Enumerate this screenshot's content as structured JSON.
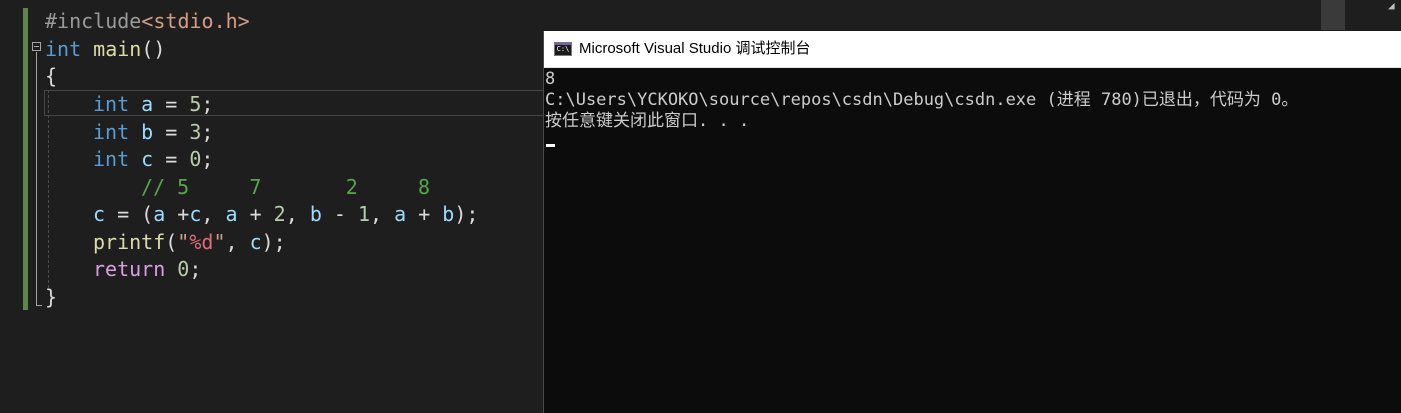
{
  "editor": {
    "lines": {
      "include_directive": "#include",
      "include_header": "<stdio.h>",
      "main_type": "int",
      "main_name": "main",
      "main_parens": "()",
      "open_brace": "{",
      "decl_a": {
        "type": "int",
        "name": "a",
        "op": " = ",
        "value": "5",
        "end": ";"
      },
      "decl_b": {
        "type": "int",
        "name": "b",
        "op": " = ",
        "value": "3",
        "end": ";"
      },
      "decl_c": {
        "type": "int",
        "name": "c",
        "op": " = ",
        "value": "0",
        "end": ";"
      },
      "comment": "// 5     7       2     8",
      "assign": {
        "lhs": "c",
        "eq": " = (",
        "a1": "a",
        "plus1": " +",
        "c1": "c",
        "comma1": ", ",
        "a2": "a",
        "plus2": " + ",
        "n2": "2",
        "comma2": ", ",
        "b1": "b",
        "minus": " - ",
        "n1": "1",
        "comma3": ", ",
        "a3": "a",
        "plus3": " + ",
        "b2": "b",
        "end": ");"
      },
      "printf_call": {
        "fn": "printf",
        "open": "(",
        "quote_open": "\"",
        "fmt": "%d",
        "quote_close": "\"",
        "sep": ", ",
        "arg": "c",
        "end": ");"
      },
      "return_stmt": {
        "kw": "return",
        "space": " ",
        "value": "0",
        "end": ";"
      },
      "close_brace": "}"
    }
  },
  "console": {
    "title": "Microsoft Visual Studio 调试控制台",
    "icon_text": "C:\\",
    "output": [
      "8",
      "C:\\Users\\YCKOKO\\source\\repos\\csdn\\Debug\\csdn.exe (进程 780)已退出，代码为 0。",
      "按任意键关闭此窗口. . ."
    ]
  }
}
